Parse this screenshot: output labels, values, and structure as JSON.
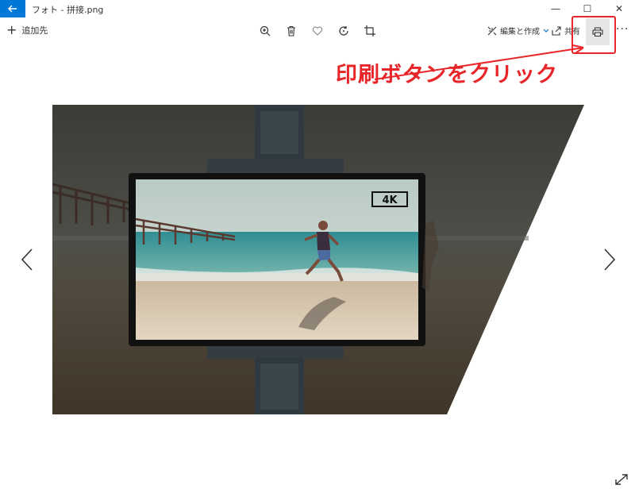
{
  "window": {
    "title": "フォト - 拼接.png",
    "controls": [
      "—",
      "☐",
      "✕"
    ]
  },
  "toolbar": {
    "add_to_label": "追加先",
    "edit_create_label": "編集と作成",
    "share_label": "共有",
    "more_label": "···"
  },
  "annotation": {
    "text": "印刷ボタンをクリック",
    "color": "#e8262a"
  },
  "photo": {
    "badge": "4K"
  },
  "colors": {
    "accent": "#0078d7",
    "annotation": "#e8262a"
  }
}
